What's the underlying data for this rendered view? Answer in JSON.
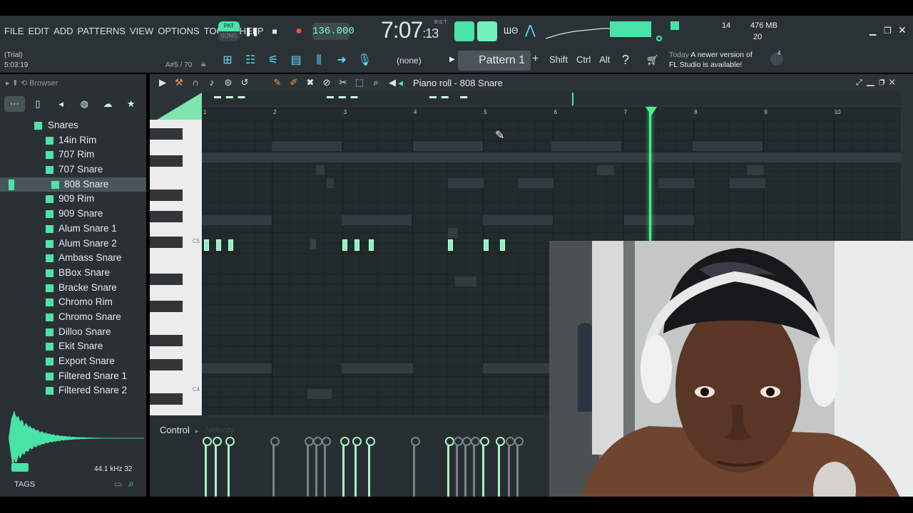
{
  "menu": [
    "FILE",
    "EDIT",
    "ADD",
    "PATTERNS",
    "VIEW",
    "OPTIONS",
    "TOOLS",
    "HELP"
  ],
  "transport": {
    "pat": "PAT",
    "song": "SONG",
    "tempo": "136.000",
    "time_main": "7:07",
    "time_sub": "13",
    "bst": "B:S:T"
  },
  "stats": {
    "cpu": "14",
    "mem": "476 MB",
    "voices": "20"
  },
  "trial": {
    "label": "(Trial)",
    "time": "5:03:19"
  },
  "note_hint": "A#5 / 70",
  "pattern": {
    "none": "(none)",
    "name": "Pattern 1",
    "plus": "+"
  },
  "modifiers": [
    "Shift",
    "Ctrl",
    "Alt"
  ],
  "news": {
    "today": "Today",
    "line1": "A newer version of",
    "line2": "FL Studio is available!",
    "count": "4"
  },
  "browser": {
    "title": "Browser",
    "folder": "Snares",
    "items": [
      "14in Rim",
      "707 Rim",
      "707 Snare",
      "808 Snare",
      "909 Rim",
      "909 Snare",
      "Alum Snare 1",
      "Alum Snare 2",
      "Ambass Snare",
      "BBox Snare",
      "Bracke Snare",
      "Chromo Rim",
      "Chromo Snare",
      "Dilloo Snare",
      "Ekit Snare",
      "Export Snare",
      "Filtered Snare 1",
      "Filtered Snare 2"
    ],
    "selected": "808 Snare",
    "sample_info": "44.1 kHz 32",
    "tags": "TAGS"
  },
  "piano_roll": {
    "title": "Piano roll - 808 Snare",
    "ruler": [
      "1",
      "2",
      "3",
      "4",
      "5",
      "6",
      "7",
      "8",
      "9",
      "10"
    ],
    "key_c5": "C5",
    "key_c4": "C4",
    "control": "Control",
    "control_sub": "Velocity"
  },
  "colors": {
    "accent": "#49e3a8",
    "note": "#90f0c0",
    "playhead": "#43f48e",
    "panel": "#2b3236"
  }
}
